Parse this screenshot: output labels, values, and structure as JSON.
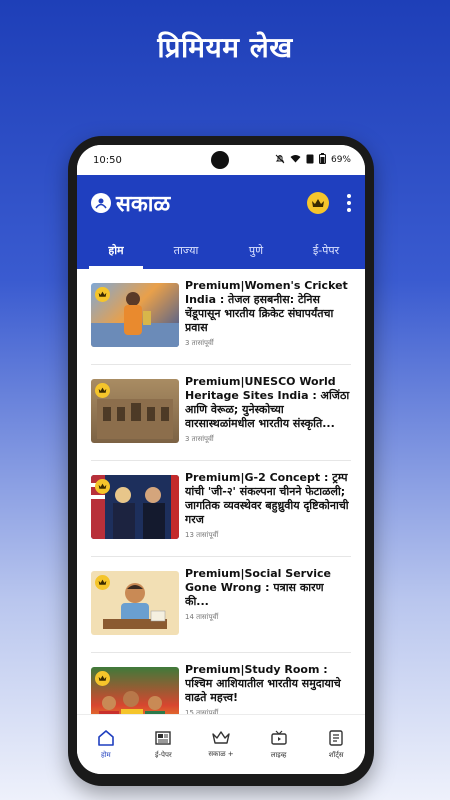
{
  "promo": {
    "title": "प्रिमियम लेख"
  },
  "status": {
    "time": "10:50",
    "battery": "69%"
  },
  "app": {
    "logo_text": "सकाळ"
  },
  "tabs": [
    {
      "label": "होम"
    },
    {
      "label": "ताज्या"
    },
    {
      "label": "पुणे"
    },
    {
      "label": "ई-पेपर"
    }
  ],
  "articles": [
    {
      "title": "Premium|Women's Cricket India : तेजल हसबनीस: टेनिस चेंडूपासून भारतीय क्रिकेट संघापर्यंतचा प्रवास",
      "time": "3 तासांपूर्वी"
    },
    {
      "title": "Premium|UNESCO World Heritage Sites India : अजिंठा आणि वेरूळ; युनेस्कोच्या वारसास्थळांमधील भारतीय संस्कृति...",
      "time": "3 तासांपूर्वी"
    },
    {
      "title": "Premium|G-2 Concept : ट्रम्प यांची 'जी-२' संकल्पना चीनने फेटाळली; जागतिक व्यवस्थेवर बहुध्रुवीय दृष्टिकोनाची गरज",
      "time": "13 तासांपूर्वी"
    },
    {
      "title": "Premium|Social Service Gone Wrong : पत्रास कारण की...",
      "time": "14 तासांपूर्वी"
    },
    {
      "title": "Premium|Study Room : पश्चिम आशियातील भारतीय समुदायाचे वाढते महत्त्व!",
      "time": "15 तासांपूर्वी"
    }
  ],
  "bottom_nav": [
    {
      "label": "होम"
    },
    {
      "label": "ई-पेपर"
    },
    {
      "label": "सकाळ +"
    },
    {
      "label": "लाइव्ह"
    },
    {
      "label": "शॉर्ट्स"
    }
  ],
  "colors": {
    "brand_blue": "#1f3fbf",
    "crown_gold": "#f5c52b"
  }
}
